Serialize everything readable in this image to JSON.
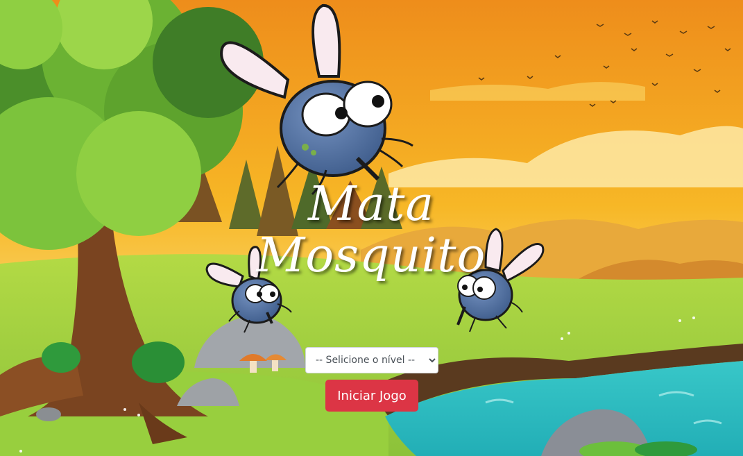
{
  "game": {
    "title_line1": "Mata",
    "title_line2": "Mosquito",
    "level_select": {
      "selected": "-- Selicione o nível --",
      "options": [
        "-- Selicione o nível --"
      ]
    },
    "start_button_label": "Iniciar Jogo"
  },
  "colors": {
    "button_bg": "#dc3545",
    "sky_top": "#f2a21f",
    "grass": "#9fd13a",
    "river": "#2fc2c4",
    "mosquito_body": "#4f6f9e",
    "wing": "#f9eaef"
  },
  "icons": [
    "mosquito-icon",
    "tree-icon",
    "mushroom-icon",
    "bird-icon",
    "leaf-icon"
  ]
}
